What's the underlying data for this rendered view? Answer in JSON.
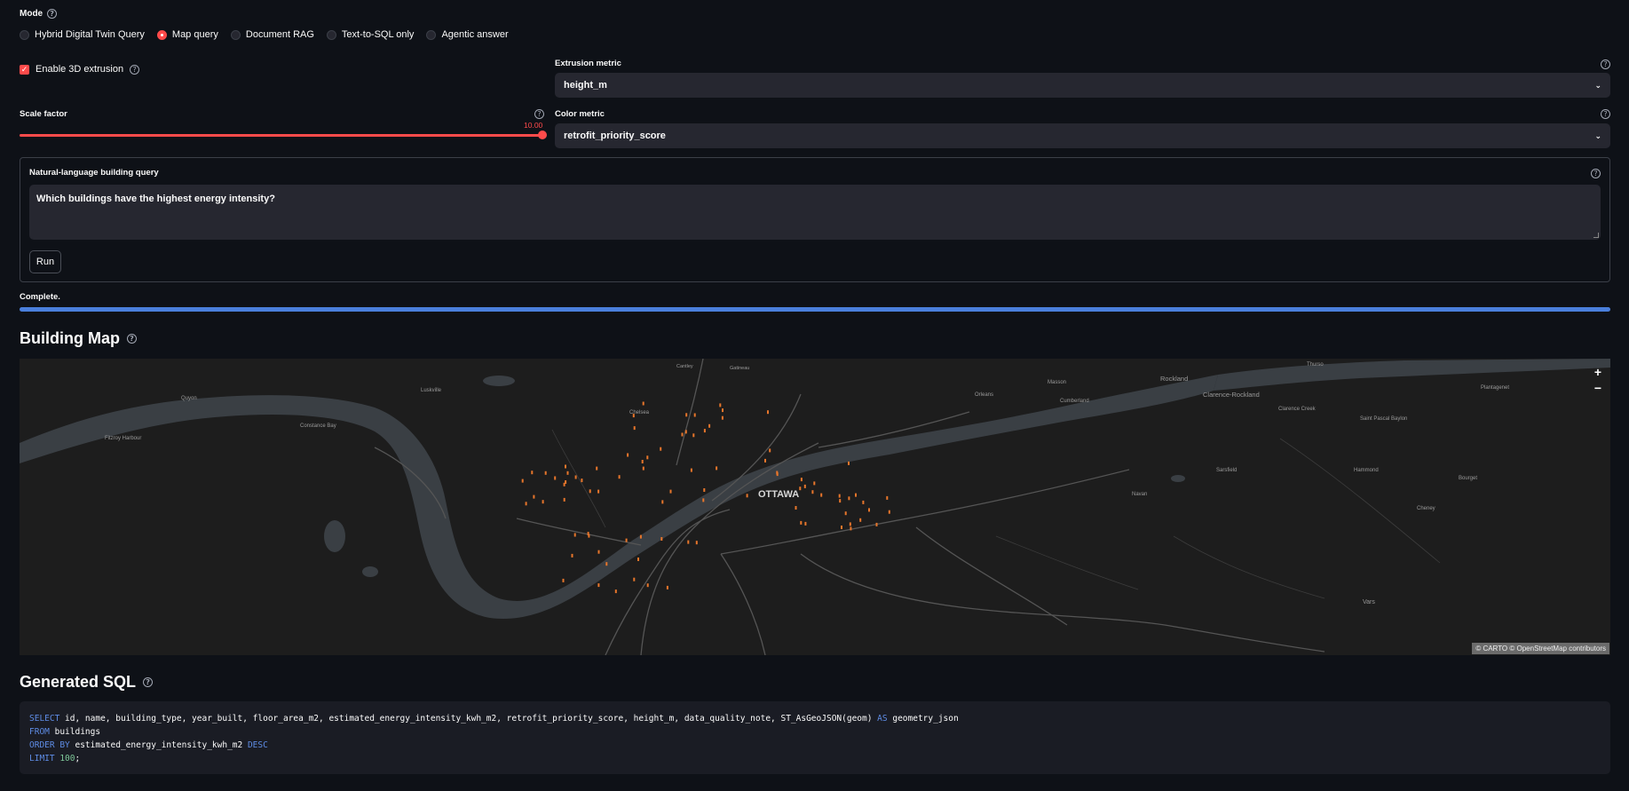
{
  "mode": {
    "label": "Mode",
    "options": [
      "Hybrid Digital Twin Query",
      "Map query",
      "Document RAG",
      "Text-to-SQL only",
      "Agentic answer"
    ],
    "selected_index": 1
  },
  "extrusion": {
    "checkbox_label": "Enable 3D extrusion",
    "checked": true
  },
  "extrusion_metric": {
    "label": "Extrusion metric",
    "value": "height_m"
  },
  "scale_factor": {
    "label": "Scale factor",
    "value": "10.00",
    "fraction": 1.0
  },
  "color_metric": {
    "label": "Color metric",
    "value": "retrofit_priority_score"
  },
  "query_form": {
    "label": "Natural-language building query",
    "value": "Which buildings have the highest energy intensity?",
    "run_label": "Run"
  },
  "status": {
    "text": "Complete.",
    "progress": 1.0
  },
  "building_map": {
    "title": "Building Map",
    "zoom_in": "+",
    "zoom_out": "−",
    "attribution": "© CARTO © OpenStreetMap contributors",
    "places": [
      "OTTAWA",
      "Rockland",
      "Clarence-Rockland",
      "Clarence Creek",
      "Saint Pascal Baylon",
      "Plantagenet",
      "Cumberland",
      "Orleans",
      "Navan",
      "Sarsfield",
      "Hammond",
      "Bourget",
      "Cheney",
      "Vars",
      "Chelsea",
      "Luskville",
      "Quyon",
      "Constance Bay",
      "Fitzroy Harbour",
      "Gatineau",
      "Cantley",
      "Masson",
      "Thurso"
    ]
  },
  "generated_sql": {
    "title": "Generated SQL",
    "line1": {
      "kw": "SELECT",
      "rest": " id, name, building_type, year_built, floor_area_m2, estimated_energy_intensity_kwh_m2, retrofit_priority_score, height_m, data_quality_note, ST_AsGeoJSON(geom) ",
      "kw2": "AS",
      "rest2": " geometry_json"
    },
    "line2": {
      "kw": "FROM",
      "rest": " buildings"
    },
    "line3": {
      "kw": "ORDER BY",
      "rest": " estimated_energy_intensity_kwh_m2 ",
      "kw2": "DESC"
    },
    "line4": {
      "kw": "LIMIT",
      "num": " 100",
      "rest": ";"
    }
  },
  "colors": {
    "accent": "#ff4b4b",
    "progress": "#4a7fdc",
    "background": "#0e1117",
    "marker": "#e8762b"
  }
}
